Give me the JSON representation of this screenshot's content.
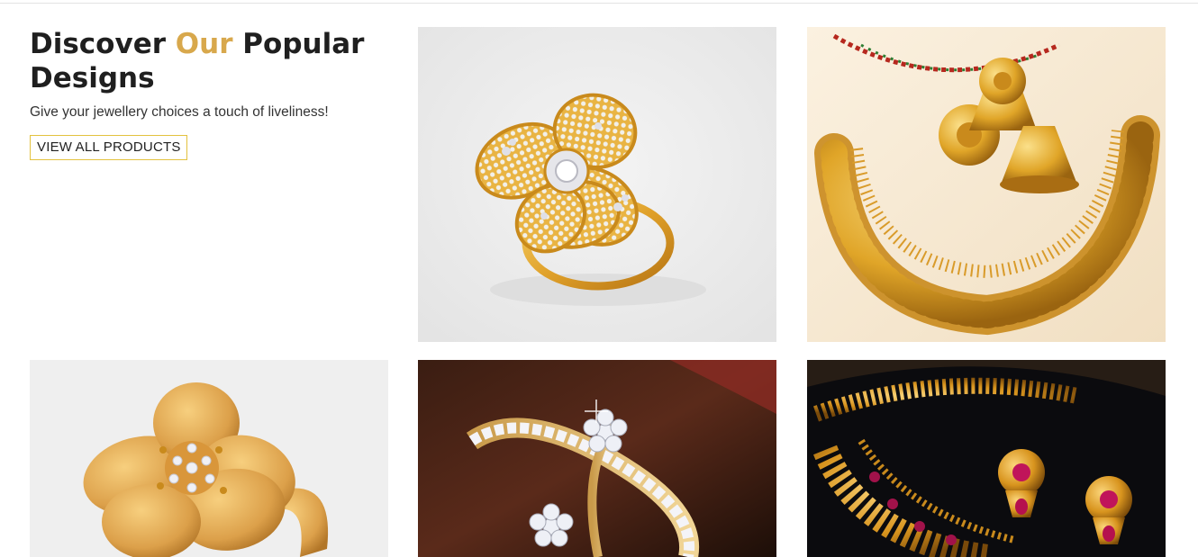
{
  "section": {
    "heading_pre": "Discover ",
    "heading_accent": "Our",
    "heading_post": " Popular Designs",
    "subtitle": "Give your jewellery choices a touch of liveliness!",
    "cta_label": "VIEW ALL PRODUCTS"
  },
  "colors": {
    "accent": "#d8a84c",
    "button_border": "#e3c23f",
    "gold": "#e0a528"
  },
  "products": [
    {
      "icon": "diamond-flower-ring-image"
    },
    {
      "icon": "gold-necklace-set-image"
    },
    {
      "icon": "gold-flower-ring-image"
    },
    {
      "icon": "diamond-star-bracelet-image"
    },
    {
      "icon": "ruby-necklace-earrings-image"
    }
  ]
}
